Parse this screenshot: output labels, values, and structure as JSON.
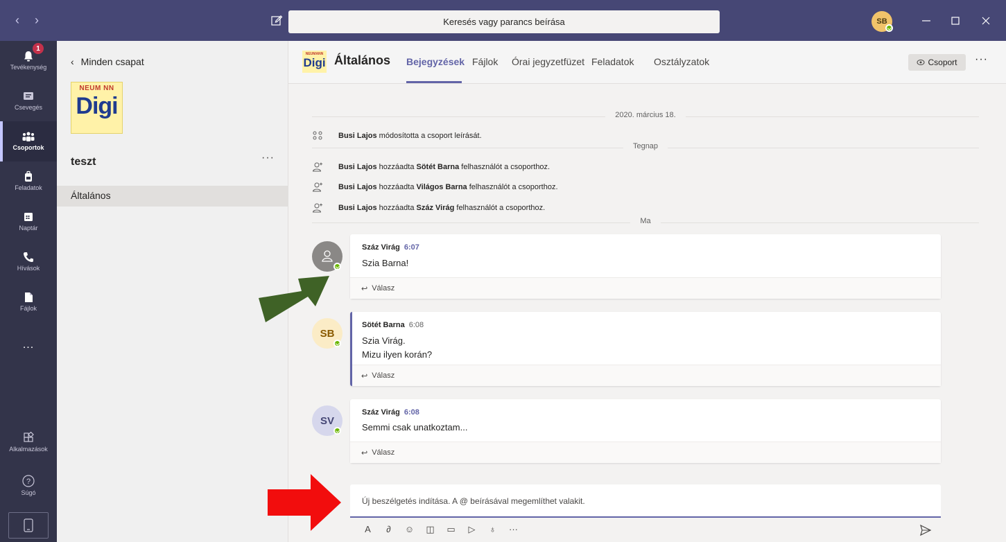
{
  "titlebar": {
    "search_placeholder": "Keresés vagy parancs beírása",
    "user_initials": "SB",
    "accent": "#464775"
  },
  "rail": {
    "items": [
      {
        "label": "Tevékenység",
        "icon": "bell-icon",
        "badge": "1"
      },
      {
        "label": "Csevegés",
        "icon": "chat-icon"
      },
      {
        "label": "Csoportok",
        "icon": "teams-icon",
        "active": true
      },
      {
        "label": "Feladatok",
        "icon": "backpack-icon"
      },
      {
        "label": "Naptár",
        "icon": "calendar-icon"
      },
      {
        "label": "Hívások",
        "icon": "phone-icon"
      },
      {
        "label": "Fájlok",
        "icon": "file-icon"
      },
      {
        "label": "...",
        "icon": "more-icon"
      }
    ],
    "apps_label": "Alkalmazások",
    "help_label": "Súgó"
  },
  "team_panel": {
    "back_label": "Minden csapat",
    "team_name": "teszt",
    "logo_top": "NEUM NN",
    "logo_main": "Digi",
    "channels": [
      "Általános"
    ]
  },
  "channel_header": {
    "name": "Általános",
    "tabs": [
      "Bejegyzések",
      "Fájlok",
      "Órai jegyzetfüzet",
      "Feladatok",
      "Osztályzatok"
    ],
    "active_tab": "Bejegyzések",
    "group_button": "Csoport",
    "logo_top": "NEUMANN",
    "logo_main": "Digi"
  },
  "feed": {
    "separators": [
      "2020. március 18.",
      "Tegnap",
      "Ma"
    ],
    "system_messages": [
      {
        "actor": "Busi Lajos",
        "pre": " módosította a csoport leírását.",
        "target": "",
        "post": ""
      },
      {
        "actor": "Busi Lajos",
        "pre": " hozzáadta ",
        "target": "Sötét Barna",
        "post": " felhasználót a csoporthoz."
      },
      {
        "actor": "Busi Lajos",
        "pre": " hozzáadta ",
        "target": "Világos Barna",
        "post": " felhasználót a csoporthoz."
      },
      {
        "actor": "Busi Lajos",
        "pre": " hozzáadta ",
        "target": "Száz Virág",
        "post": " felhasználót a csoporthoz."
      }
    ],
    "posts": [
      {
        "author": "Száz Virág",
        "time": "6:07",
        "lines": [
          "Szia Barna!"
        ],
        "avatar": "",
        "avatar_color": "#8a8886"
      },
      {
        "author": "Sötét Barna",
        "time": "6:08",
        "lines": [
          "Szia Virág.",
          "Mizu ilyen korán?"
        ],
        "avatar": "SB",
        "avatar_color": "#fbecc6"
      },
      {
        "author": "Száz Virág",
        "time": "6:08",
        "lines": [
          "Semmi csak unatkoztam..."
        ],
        "avatar": "SV",
        "avatar_color": "#d6d7ec"
      }
    ],
    "reply_label": "Válasz",
    "compose_placeholder": "Új beszélgetés indítása. A @ beírásával megemlíthet valakit."
  }
}
